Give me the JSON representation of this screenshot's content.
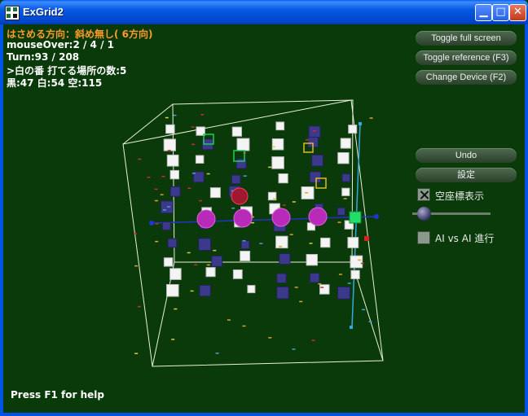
{
  "window": {
    "title": "ExGrid2"
  },
  "hud": {
    "direction": "はさめる方向：斜め無し( 6方向)",
    "mouse_over": "mouseOver:2 / 4 / 1",
    "turn": "Turn:93 / 208",
    "white_turn": ">白の番 打てる場所の数:5",
    "counts": "黒:47 白:54 空:115"
  },
  "buttons": {
    "fullscreen": "Toggle full screen",
    "reference": "Toggle reference (F3)",
    "device": "Change Device (F2)",
    "undo": "Undo",
    "settings": "設定"
  },
  "options": {
    "axis_display": "空座標表示",
    "ai_vs_ai": "AI vs AI 進行"
  },
  "footer": {
    "help": "Press F1 for help"
  },
  "colors": {
    "background": "#0a3a0a",
    "white_piece": "#f4f4f4",
    "black_piece": "#3b3a8a",
    "candidate": "#d33fd3",
    "hud_orange": "#ff9a2a"
  },
  "icons": {
    "app": "grid-app-icon",
    "minimize": "minimize-icon",
    "maximize": "maximize-icon",
    "close": "close-icon"
  }
}
